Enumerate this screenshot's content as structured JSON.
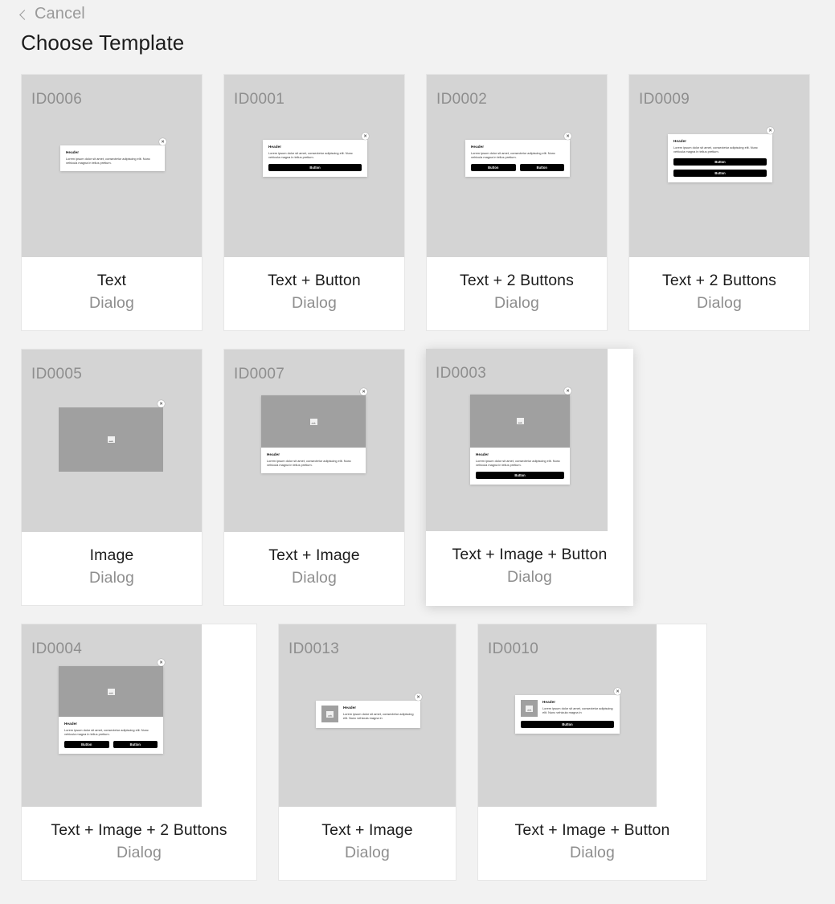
{
  "header": {
    "cancel_label": "Cancel",
    "back_icon": "chevron-left-icon",
    "title": "Choose Template"
  },
  "mock_strings": {
    "header": "Header",
    "body": "Lorem ipsum dolor sit amet, consectetur adipiscing elit. Nunc vehicula magna in tellus pretium.",
    "body_short": "Lorem ipsum dolor sit amet, consectetur adipiscing elit. Nunc vehicula magna in",
    "button": "Button",
    "close_icon": "close-icon",
    "image_icon": "image-placeholder-icon"
  },
  "colors": {
    "page_background": "#f2f2f2",
    "preview_background": "#d4d4d4",
    "card_background": "#ffffff",
    "image_placeholder": "#a0a0a0",
    "button_fill": "#000000",
    "muted_text": "#8e8e8e",
    "primary_text": "#1c1c1c"
  },
  "templates": [
    {
      "id": "ID0006",
      "name": "Text",
      "kind": "Dialog",
      "selected": false
    },
    {
      "id": "ID0001",
      "name": "Text + Button",
      "kind": "Dialog",
      "selected": false
    },
    {
      "id": "ID0002",
      "name": "Text + 2 Buttons",
      "kind": "Dialog",
      "selected": false
    },
    {
      "id": "ID0009",
      "name": "Text + 2 Buttons",
      "kind": "Dialog",
      "selected": false
    },
    {
      "id": "ID0005",
      "name": "Image",
      "kind": "Dialog",
      "selected": false
    },
    {
      "id": "ID0007",
      "name": "Text + Image",
      "kind": "Dialog",
      "selected": false
    },
    {
      "id": "ID0003",
      "name": "Text + Image + Button",
      "kind": "Dialog",
      "selected": true
    },
    {
      "id": "ID0004",
      "name": "Text + Image + 2 Buttons",
      "kind": "Dialog",
      "selected": false
    },
    {
      "id": "ID0013",
      "name": "Text + Image",
      "kind": "Dialog",
      "selected": false
    },
    {
      "id": "ID0010",
      "name": "Text + Image + Button",
      "kind": "Dialog",
      "selected": false
    }
  ]
}
